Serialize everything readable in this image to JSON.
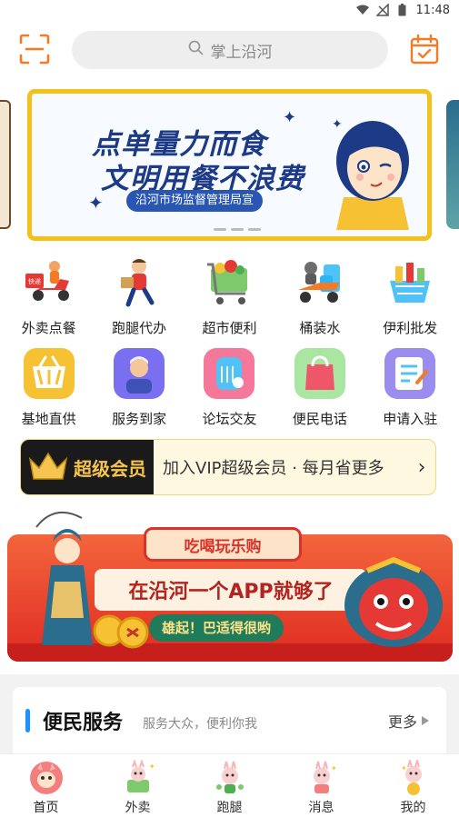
{
  "status_bar": {
    "time": "11:48"
  },
  "header": {
    "search_placeholder": "掌上沿河"
  },
  "banner": {
    "line1": "点单量力而食",
    "line2": "文明用餐不浪费",
    "sub": "沿河市场监督管理局宣"
  },
  "grid": [
    {
      "label": "外卖点餐",
      "icon": "delivery-scooter-icon",
      "badge": "快递"
    },
    {
      "label": "跑腿代办",
      "icon": "courier-runner-icon"
    },
    {
      "label": "超市便利",
      "icon": "shopping-cart-icon"
    },
    {
      "label": "桶装水",
      "icon": "water-delivery-icon"
    },
    {
      "label": "伊利批发",
      "icon": "wholesale-basket-icon"
    },
    {
      "label": "基地直供",
      "icon": "base-supply-icon"
    },
    {
      "label": "服务到家",
      "icon": "home-service-icon"
    },
    {
      "label": "论坛交友",
      "icon": "forum-icon"
    },
    {
      "label": "便民电话",
      "icon": "phone-bag-icon"
    },
    {
      "label": "申请入驻",
      "icon": "apply-icon"
    }
  ],
  "vip": {
    "title": "超级会员",
    "text": "加入VIP超级会员 · 每月省更多"
  },
  "promo": {
    "cap": "吃喝玩乐购",
    "headline": "在沿河一个APP就够了",
    "slogan": "雄起！巴适得很哟"
  },
  "service": {
    "title": "便民服务",
    "subtitle": "服务大众，便利你我",
    "more": "更多"
  },
  "tabs": [
    {
      "label": "首页",
      "icon": "home-tab-icon"
    },
    {
      "label": "外卖",
      "icon": "takeout-tab-icon"
    },
    {
      "label": "跑腿",
      "icon": "errand-tab-icon"
    },
    {
      "label": "消息",
      "icon": "message-tab-icon"
    },
    {
      "label": "我的",
      "icon": "profile-tab-icon"
    }
  ],
  "colors": {
    "accent": "#f47a23",
    "vip_gold": "#f5c451",
    "link_blue": "#1e90ff",
    "banner_border": "#f2c21a",
    "promo_red": "#df2b22"
  }
}
